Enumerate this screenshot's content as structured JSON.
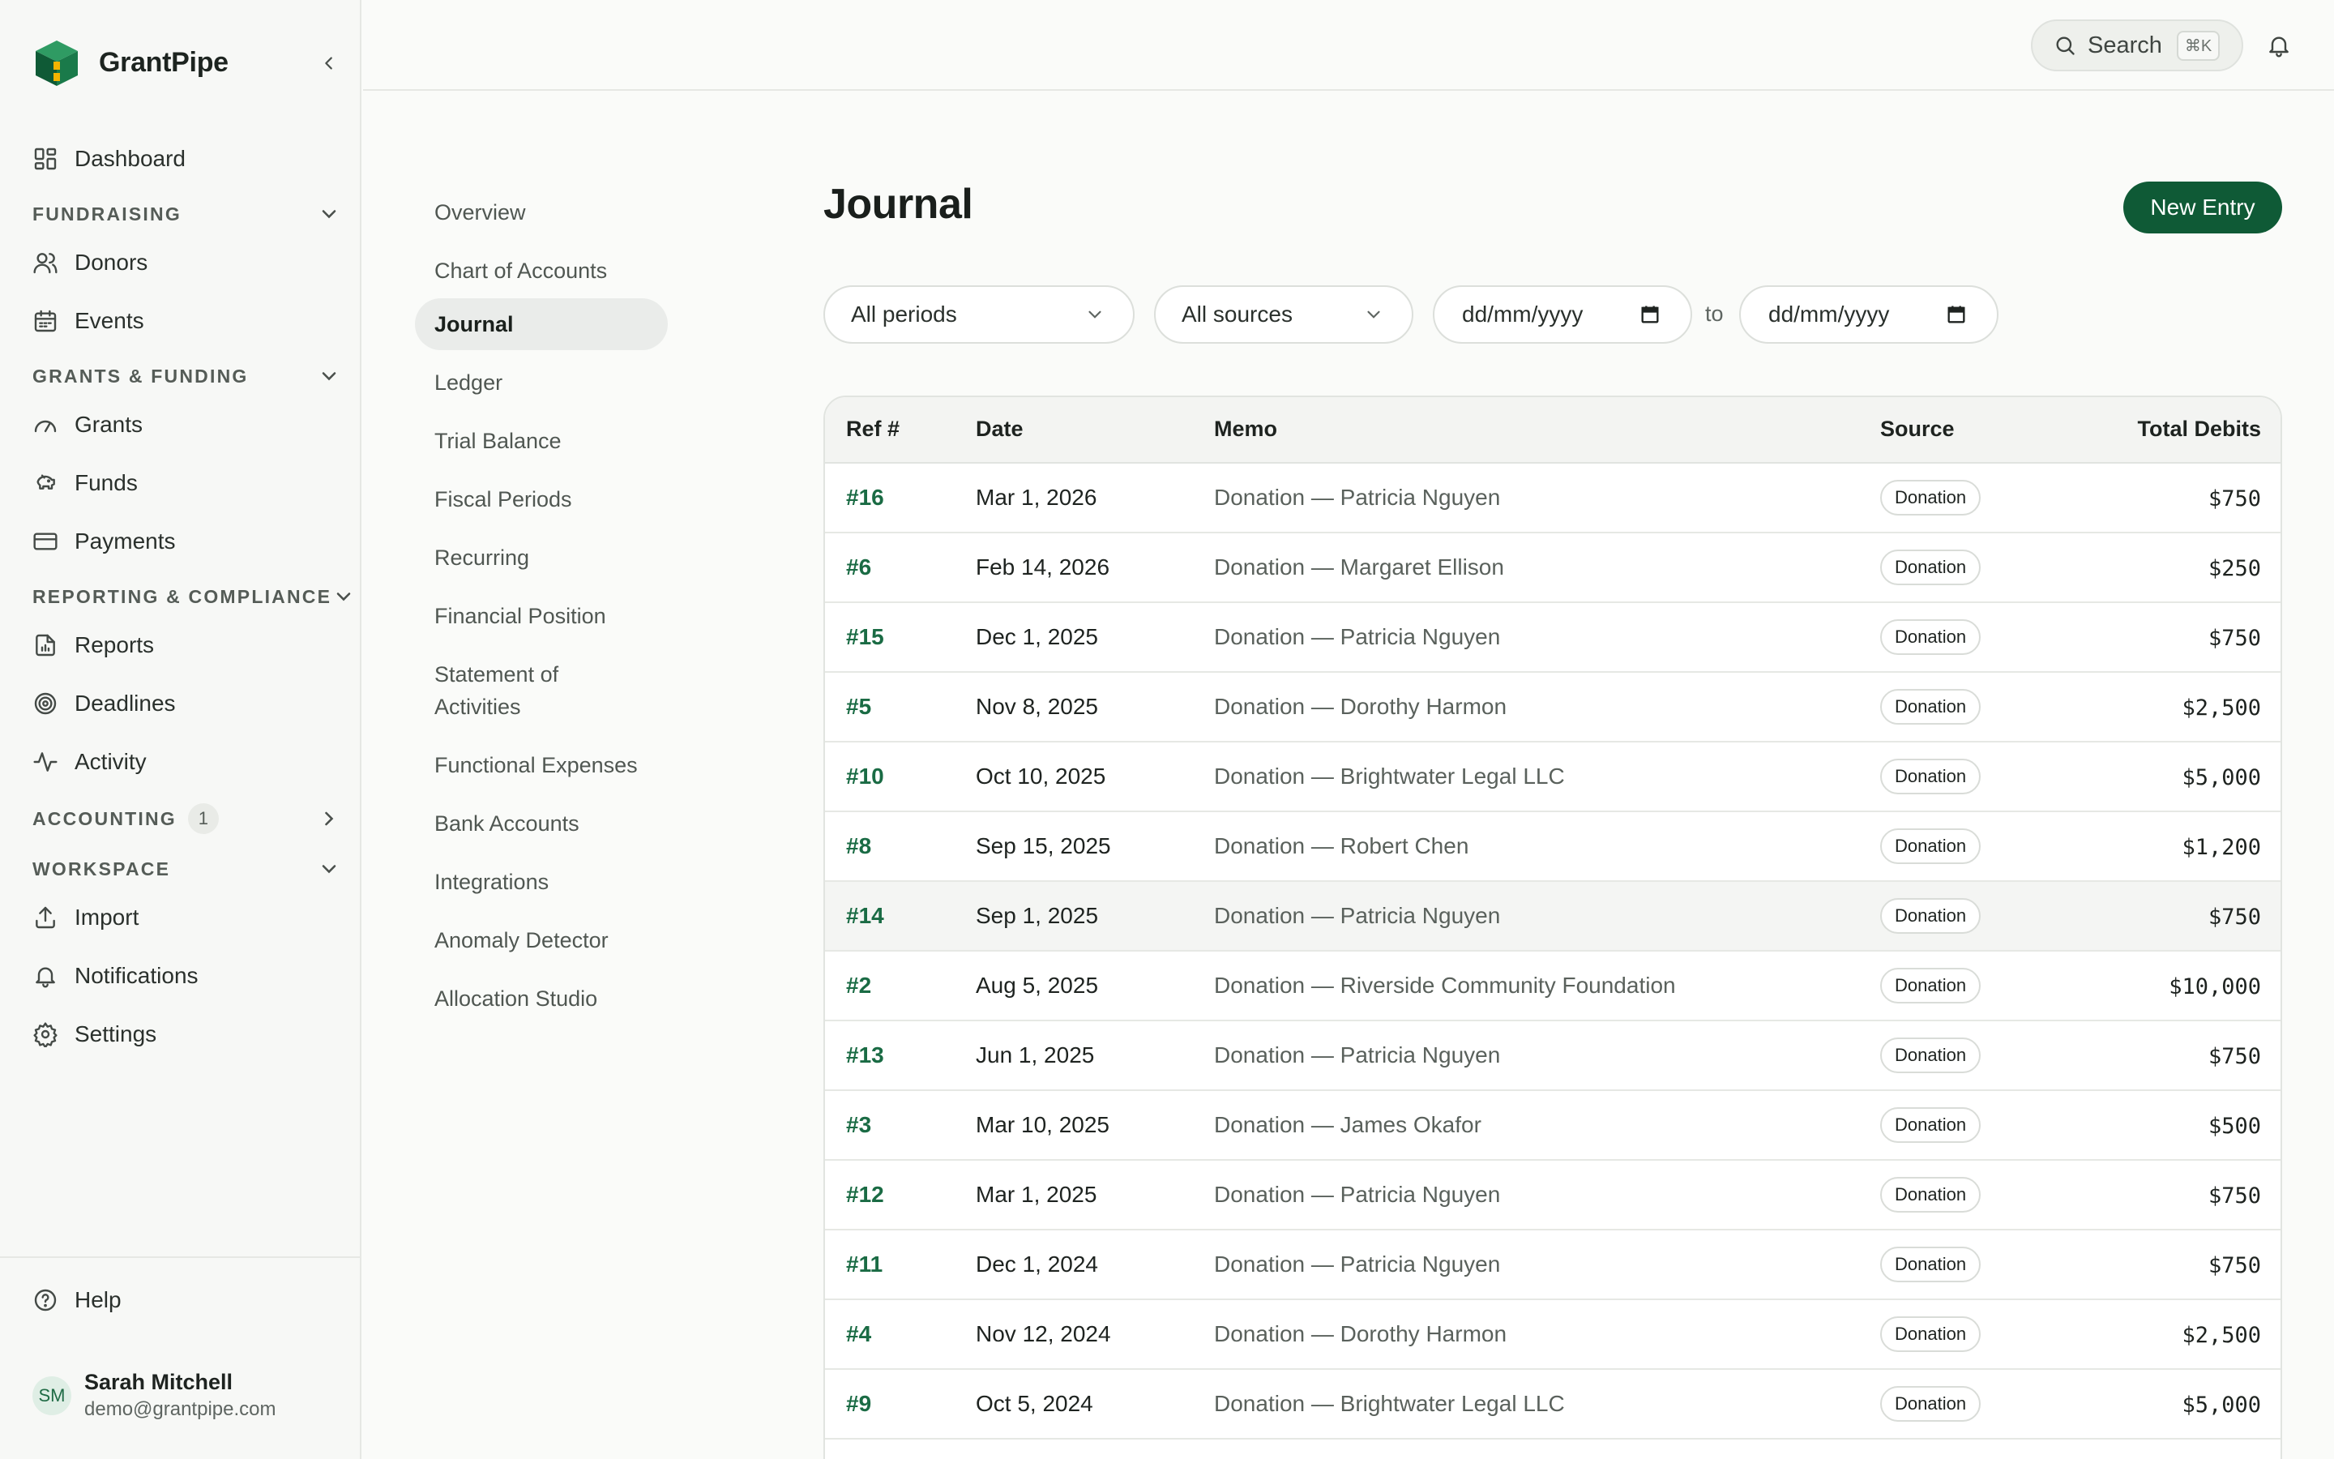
{
  "app": {
    "name": "GrantPipe",
    "colors": {
      "accent": "#0f5a36",
      "link": "#1a6b44"
    }
  },
  "sidebar": {
    "dashboard": "Dashboard",
    "sections": {
      "fundraising": "FUNDRAISING",
      "grants": "GRANTS & FUNDING",
      "reporting": "REPORTING & COMPLIANCE",
      "accounting": "ACCOUNTING",
      "accounting_count": "1",
      "workspace": "WORKSPACE"
    },
    "items": {
      "donors": "Donors",
      "events": "Events",
      "grants": "Grants",
      "funds": "Funds",
      "payments": "Payments",
      "reports": "Reports",
      "deadlines": "Deadlines",
      "activity": "Activity",
      "import": "Import",
      "notifications": "Notifications",
      "settings": "Settings",
      "help": "Help"
    },
    "user": {
      "initials": "SM",
      "name": "Sarah Mitchell",
      "email": "demo@grantpipe.com"
    }
  },
  "topbar": {
    "search_label": "Search",
    "search_shortcut": "⌘K"
  },
  "subnav": [
    "Overview",
    "Chart of Accounts",
    "Journal",
    "Ledger",
    "Trial Balance",
    "Fiscal Periods",
    "Recurring",
    "Financial Position",
    "Statement of Activities",
    "Functional Expenses",
    "Bank Accounts",
    "Integrations",
    "Anomaly Detector",
    "Allocation Studio"
  ],
  "page": {
    "title": "Journal",
    "new_entry_label": "New Entry",
    "filters": {
      "period": "All periods",
      "source": "All sources",
      "date_from_placeholder": "dd/mm/yyyy",
      "date_to_placeholder": "dd/mm/yyyy",
      "to_label": "to"
    }
  },
  "table": {
    "columns": [
      "Ref #",
      "Date",
      "Memo",
      "Source",
      "Total Debits"
    ],
    "rows": [
      {
        "ref": "#16",
        "date": "Mar 1, 2026",
        "memo": "Donation — Patricia Nguyen",
        "source": "Donation",
        "amount": "$750"
      },
      {
        "ref": "#6",
        "date": "Feb 14, 2026",
        "memo": "Donation — Margaret Ellison",
        "source": "Donation",
        "amount": "$250"
      },
      {
        "ref": "#15",
        "date": "Dec 1, 2025",
        "memo": "Donation — Patricia Nguyen",
        "source": "Donation",
        "amount": "$750"
      },
      {
        "ref": "#5",
        "date": "Nov 8, 2025",
        "memo": "Donation — Dorothy Harmon",
        "source": "Donation",
        "amount": "$2,500"
      },
      {
        "ref": "#10",
        "date": "Oct 10, 2025",
        "memo": "Donation — Brightwater Legal LLC",
        "source": "Donation",
        "amount": "$5,000"
      },
      {
        "ref": "#8",
        "date": "Sep 15, 2025",
        "memo": "Donation — Robert Chen",
        "source": "Donation",
        "amount": "$1,200"
      },
      {
        "ref": "#14",
        "date": "Sep 1, 2025",
        "memo": "Donation — Patricia Nguyen",
        "source": "Donation",
        "amount": "$750"
      },
      {
        "ref": "#2",
        "date": "Aug 5, 2025",
        "memo": "Donation — Riverside Community Foundation",
        "source": "Donation",
        "amount": "$10,000"
      },
      {
        "ref": "#13",
        "date": "Jun 1, 2025",
        "memo": "Donation — Patricia Nguyen",
        "source": "Donation",
        "amount": "$750"
      },
      {
        "ref": "#3",
        "date": "Mar 10, 2025",
        "memo": "Donation — James Okafor",
        "source": "Donation",
        "amount": "$500"
      },
      {
        "ref": "#12",
        "date": "Mar 1, 2025",
        "memo": "Donation — Patricia Nguyen",
        "source": "Donation",
        "amount": "$750"
      },
      {
        "ref": "#11",
        "date": "Dec 1, 2024",
        "memo": "Donation — Patricia Nguyen",
        "source": "Donation",
        "amount": "$750"
      },
      {
        "ref": "#4",
        "date": "Nov 12, 2024",
        "memo": "Donation — Dorothy Harmon",
        "source": "Donation",
        "amount": "$2,500"
      },
      {
        "ref": "#9",
        "date": "Oct 5, 2024",
        "memo": "Donation — Brightwater Legal LLC",
        "source": "Donation",
        "amount": "$5,000"
      }
    ]
  }
}
